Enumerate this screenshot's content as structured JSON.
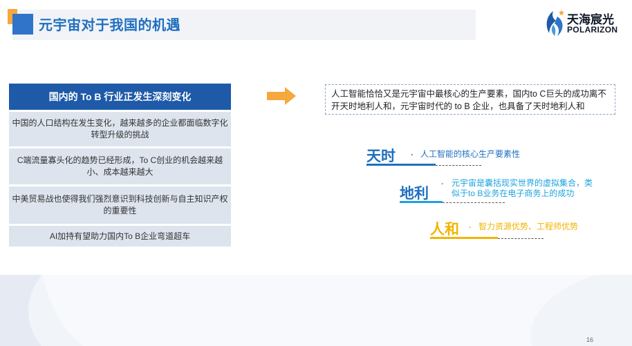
{
  "header": {
    "title": "元宇宙对于我国的机遇",
    "logo_name": "天海宸光",
    "logo_en": "POLARIZON"
  },
  "panel": {
    "heading": "国内的 To B 行业正发生深刻变化",
    "items": [
      "中国的人口结构在发生变化，越来越多的企业都面临数字化转型升级的挑战",
      "C端流量寡头化的趋势已经形成，To C创业的机会越来越小、成本越来越大",
      "中美贸易战也使得我们强烈意识到科技创新与自主知识产权的重要性",
      "AI加持有望助力国内To B企业弯道超车"
    ]
  },
  "quote": "人工智能恰恰又是元宇宙中最核心的生产要素，国内to C巨头的成功离不开天时地利人和，元宇宙时代的 to B 企业，也具备了天时地利人和",
  "factors": [
    {
      "word": "天时",
      "text": "人工智能的核心生产要素性"
    },
    {
      "word": "地利",
      "text": "元宇宙是囊括现实世界的虚拟集合，类似于to B业务在电子商务上的成功"
    },
    {
      "word": "人和",
      "text": "智力资源优势、工程师优势"
    }
  ],
  "bullet": "·",
  "page_number": "16",
  "colors": {
    "title_blue": "#1f6fc0",
    "accent_orange": "#f5a83d",
    "panel_header": "#1e5aa8",
    "panel_item": "#dde4ee",
    "tianshi": "#1f6fc0",
    "dili": "#1aa3e0",
    "renhe": "#f1b400"
  },
  "icons": [
    "right-arrow-icon",
    "polarizon-logo-icon"
  ]
}
